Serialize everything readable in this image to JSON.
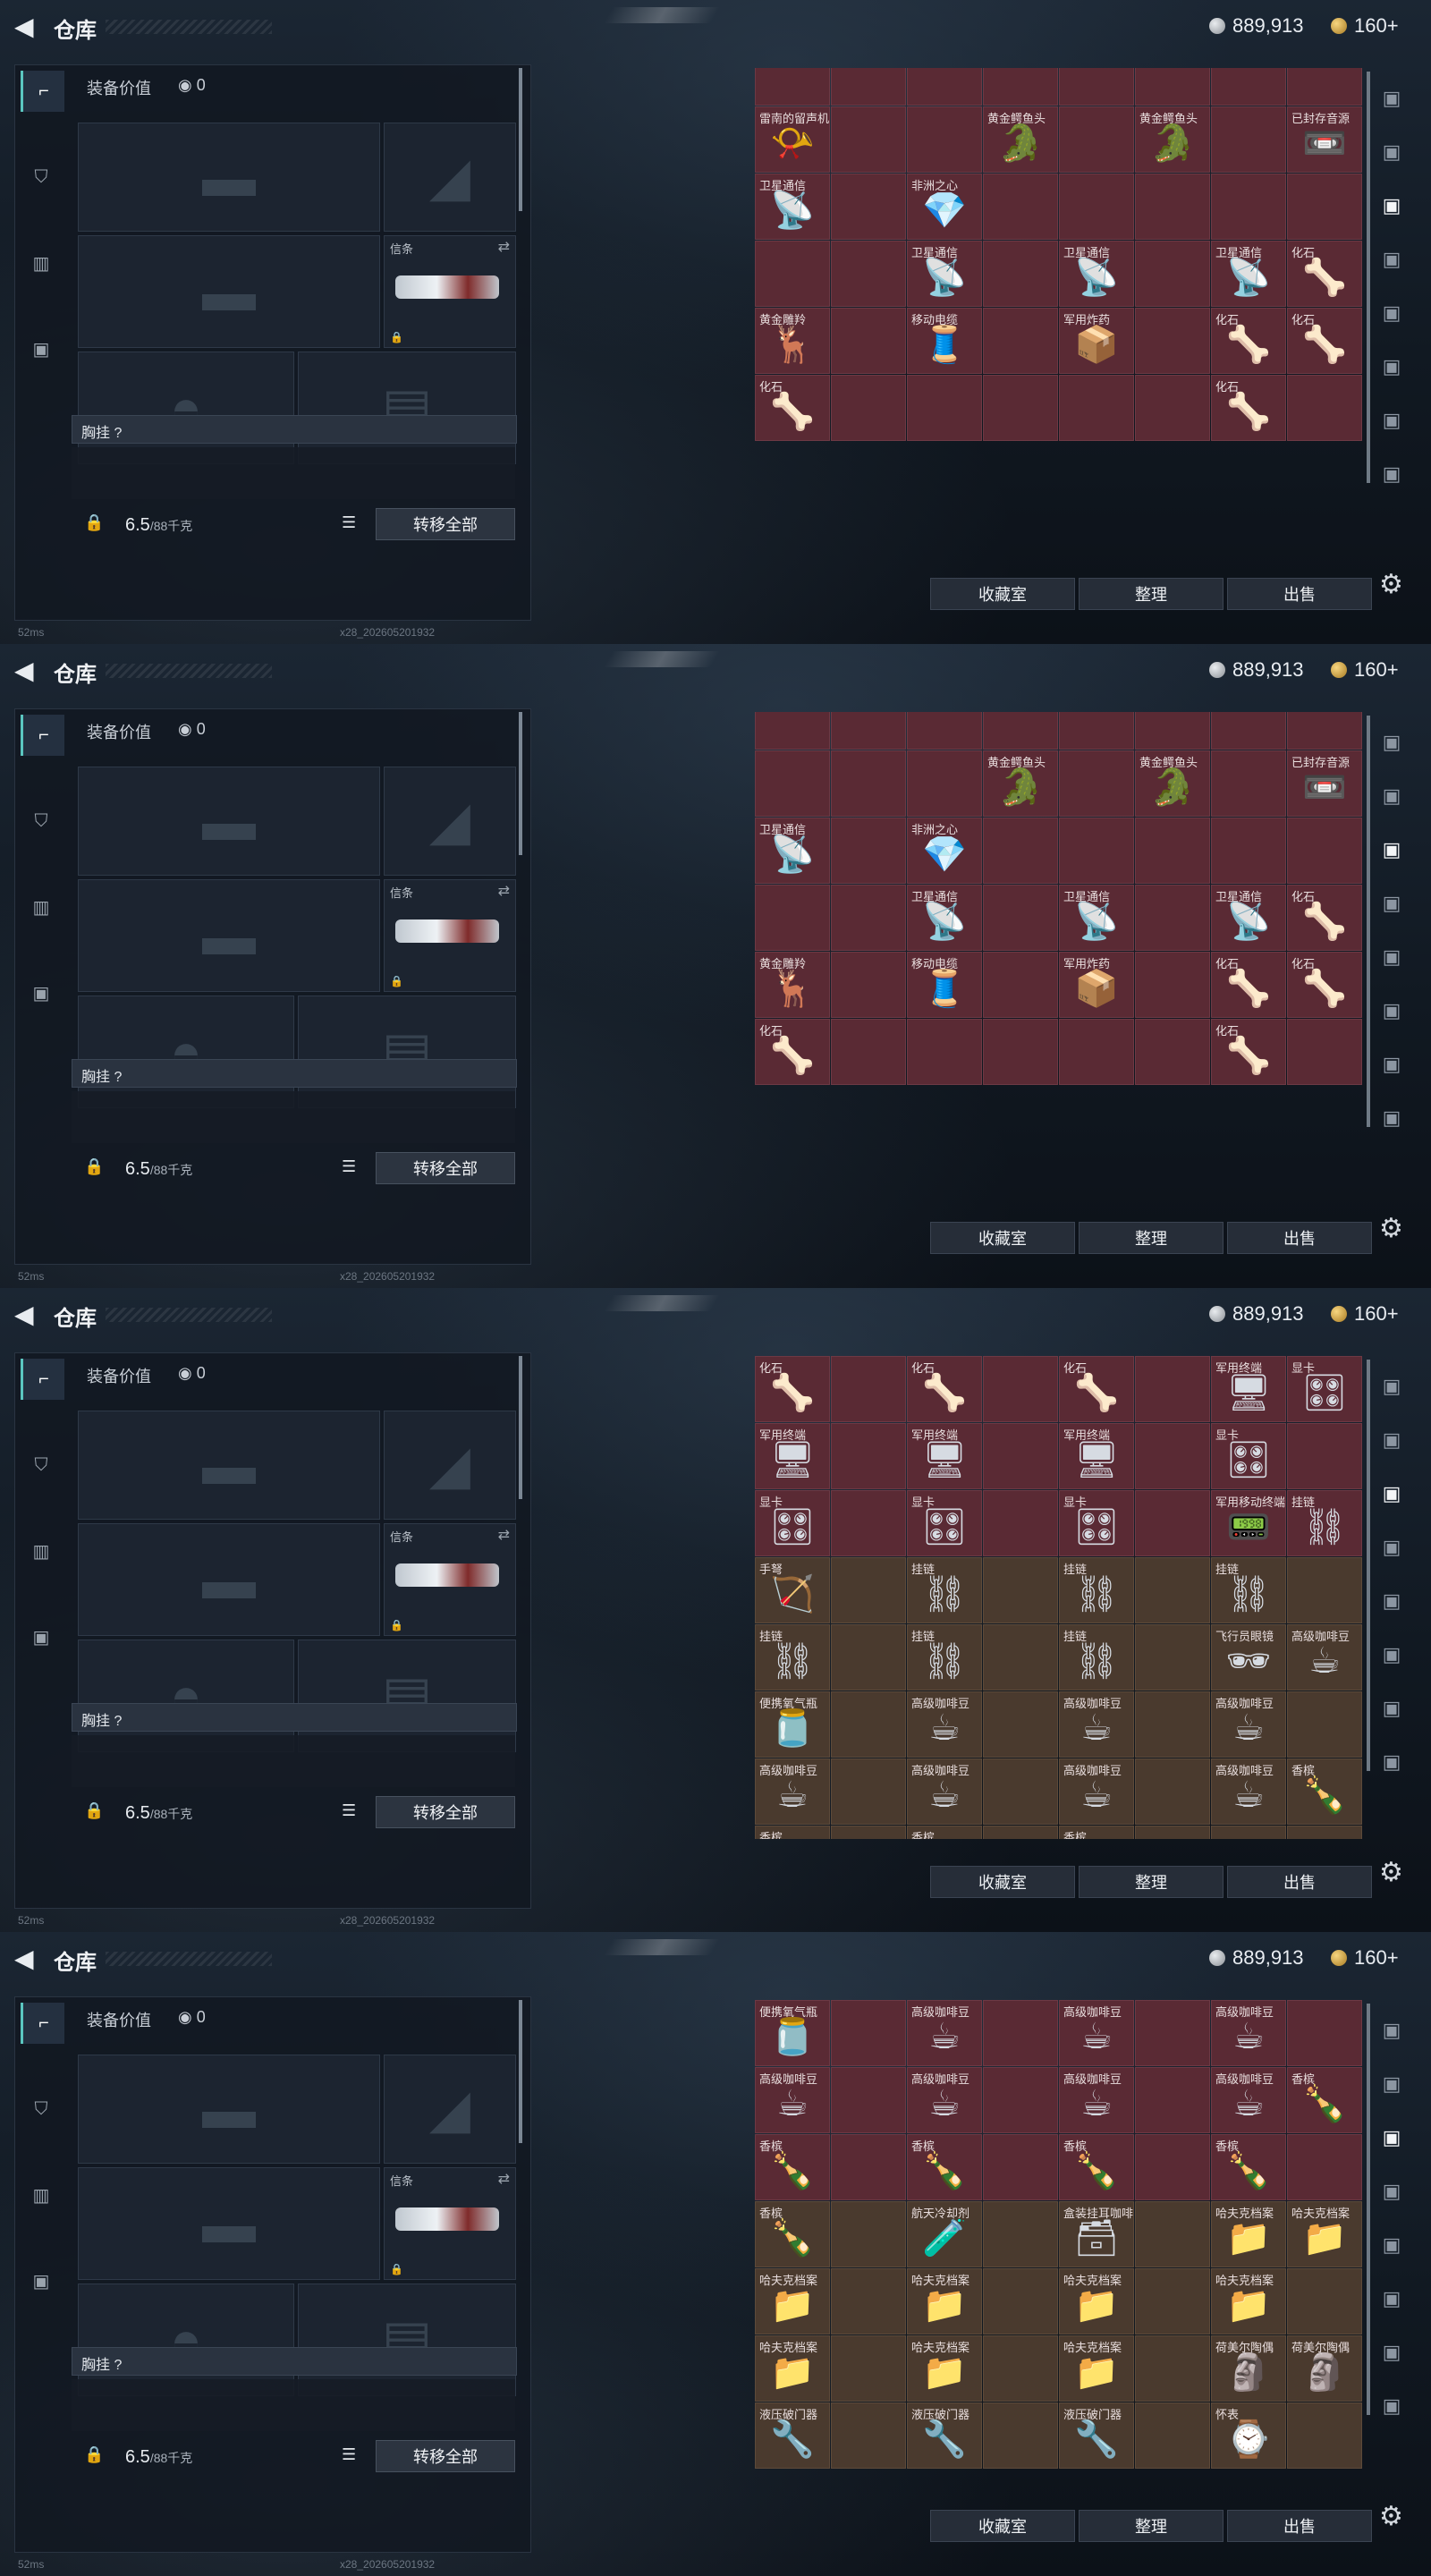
{
  "header": {
    "title": "仓库",
    "silver": "889,913",
    "gold": "160+"
  },
  "loadout": {
    "value_label": "装备价值",
    "value": "0",
    "knife_label": "信条",
    "chest_label": "胸挂 ?",
    "weight": "6.5",
    "weight_cap": "/88千克",
    "transfer_all": "转移全部"
  },
  "status": {
    "ping": "52ms",
    "build": "x28_202605201932"
  },
  "actions": {
    "collection": "收藏室",
    "sort": "整理",
    "sell": "出售"
  },
  "panels": [
    {
      "rows": [
        [
          "",
          "",
          "",
          "",
          "",
          "",
          "",
          ""
        ],
        [
          "雷南的留声机",
          "",
          "",
          "黄金鳄鱼头",
          "",
          "黄金鳄鱼头",
          "",
          "已封存音源"
        ],
        [
          "卫星通信",
          "",
          "非洲之心",
          "",
          "",
          "",
          "",
          ""
        ],
        [
          "",
          "",
          "卫星通信",
          "",
          "卫星通信",
          "",
          "卫星通信",
          "化石"
        ],
        [
          "黄金雕羚",
          "",
          "移动电缆",
          "",
          "军用炸药",
          "",
          "化石",
          "化石"
        ],
        [
          "化石",
          "",
          "",
          "",
          "",
          "",
          "化石",
          ""
        ]
      ]
    },
    {
      "rows": [
        [
          "",
          "",
          "",
          "",
          "",
          "",
          "",
          ""
        ],
        [
          "",
          "",
          "",
          "黄金鳄鱼头",
          "",
          "黄金鳄鱼头",
          "",
          "已封存音源"
        ],
        [
          "卫星通信",
          "",
          "非洲之心",
          "",
          "",
          "",
          "",
          ""
        ],
        [
          "",
          "",
          "卫星通信",
          "",
          "卫星通信",
          "",
          "卫星通信",
          "化石"
        ],
        [
          "黄金雕羚",
          "",
          "移动电缆",
          "",
          "军用炸药",
          "",
          "化石",
          "化石"
        ],
        [
          "化石",
          "",
          "",
          "",
          "",
          "",
          "化石",
          ""
        ]
      ]
    },
    {
      "rows": [
        [
          "化石",
          "",
          "化石",
          "",
          "化石",
          "",
          "军用终端",
          "显卡"
        ],
        [
          "军用终端",
          "",
          "军用终端",
          "",
          "军用终端",
          "",
          "显卡",
          ""
        ],
        [
          "显卡",
          "",
          "显卡",
          "",
          "显卡",
          "",
          "军用移动终端",
          "挂链"
        ],
        [
          "手弩",
          "",
          "挂链",
          "",
          "挂链",
          "",
          "挂链",
          ""
        ],
        [
          "挂链",
          "",
          "挂链",
          "",
          "挂链",
          "",
          "飞行员眼镜",
          "高级咖啡豆"
        ],
        [
          "便携氧气瓶",
          "",
          "高级咖啡豆",
          "",
          "高级咖啡豆",
          "",
          "高级咖啡豆",
          ""
        ],
        [
          "高级咖啡豆",
          "",
          "高级咖啡豆",
          "",
          "高级咖啡豆",
          "",
          "高级咖啡豆",
          "香槟"
        ],
        [
          "香槟",
          "",
          "香槟",
          "",
          "香槟",
          "",
          "",
          ""
        ]
      ]
    },
    {
      "rows": [
        [
          "便携氧气瓶",
          "",
          "高级咖啡豆",
          "",
          "高级咖啡豆",
          "",
          "高级咖啡豆",
          ""
        ],
        [
          "高级咖啡豆",
          "",
          "高级咖啡豆",
          "",
          "高级咖啡豆",
          "",
          "高级咖啡豆",
          "香槟"
        ],
        [
          "香槟",
          "",
          "香槟",
          "",
          "香槟",
          "",
          "香槟",
          ""
        ],
        [
          "香槟",
          "",
          "航天冷却剂",
          "",
          "盒装挂耳咖啡",
          "",
          "哈夫克档案",
          "哈夫克档案"
        ],
        [
          "哈夫克档案",
          "",
          "哈夫克档案",
          "",
          "哈夫克档案",
          "",
          "哈夫克档案",
          ""
        ],
        [
          "哈夫克档案",
          "",
          "哈夫克档案",
          "",
          "哈夫克档案",
          "",
          "荷美尔陶偶",
          "荷美尔陶偶"
        ],
        [
          "液压破门器",
          "",
          "液压破门器",
          "",
          "液压破门器",
          "",
          "怀表",
          ""
        ]
      ]
    }
  ],
  "icons": [
    "back-arrow-icon",
    "silver-coin-icon",
    "gold-coin-icon",
    "weapon-tab-icon",
    "armor-tab-icon",
    "backpack-tab-icon",
    "case-tab-icon",
    "lock-icon",
    "swap-icon",
    "list-icon",
    "gear-icon"
  ]
}
